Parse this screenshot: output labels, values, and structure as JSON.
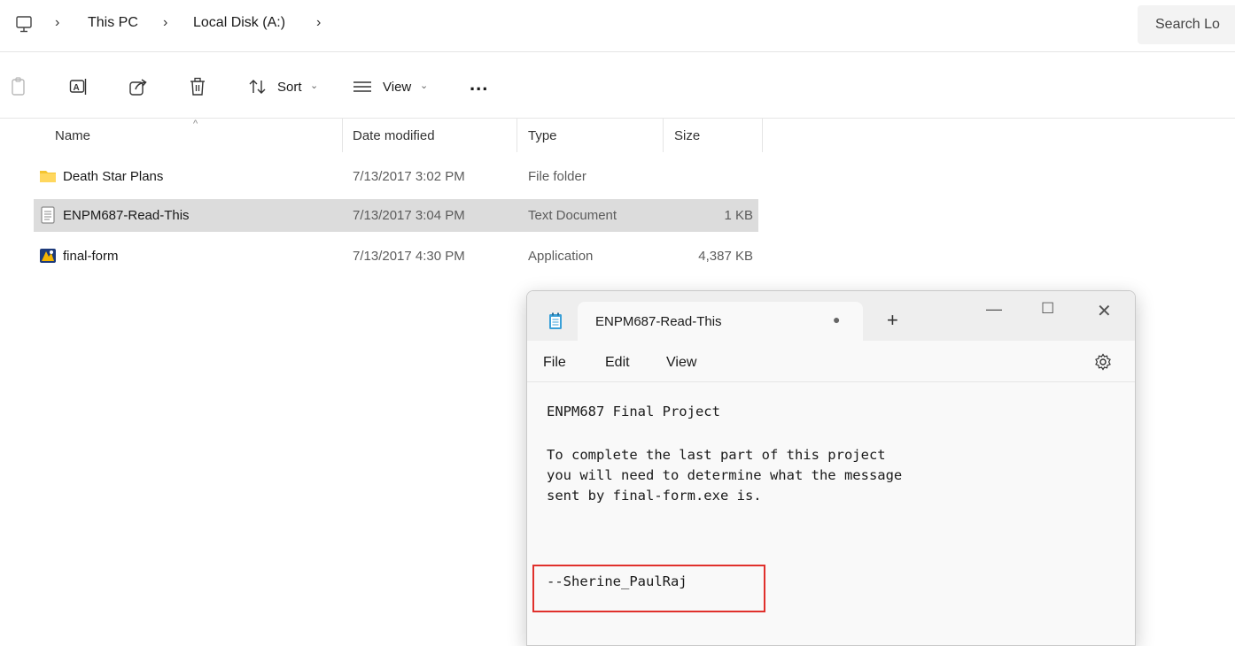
{
  "explorer": {
    "breadcrumb": [
      "This PC",
      "Local Disk (A:)"
    ],
    "search_placeholder": "Search Lo",
    "toolbar": {
      "sort_label": "Sort",
      "view_label": "View",
      "more_label": "..."
    },
    "columns": [
      "Name",
      "Date modified",
      "Type",
      "Size"
    ],
    "files": [
      {
        "name": "Death Star Plans",
        "date": "7/13/2017 3:02 PM",
        "type": "File folder",
        "size": "",
        "icon": "folder-icon"
      },
      {
        "name": "ENPM687-Read-This",
        "date": "7/13/2017 3:04 PM",
        "type": "Text Document",
        "size": "1 KB",
        "icon": "text-file-icon",
        "selected": true
      },
      {
        "name": "final-form",
        "date": "7/13/2017 4:30 PM",
        "type": "Application",
        "size": "4,387 KB",
        "icon": "application-icon"
      }
    ]
  },
  "notepad": {
    "tab_title": "ENPM687-Read-This",
    "unsaved_indicator": "●",
    "new_tab": "+",
    "menu": [
      "File",
      "Edit",
      "View"
    ],
    "lines": [
      "ENPM687 Final Project",
      "To complete the last part of this project",
      "you will need to determine what the message",
      "sent by final-form.exe is.",
      "--Sherine_PaulRaj"
    ],
    "highlight_color": "#e0302c"
  }
}
